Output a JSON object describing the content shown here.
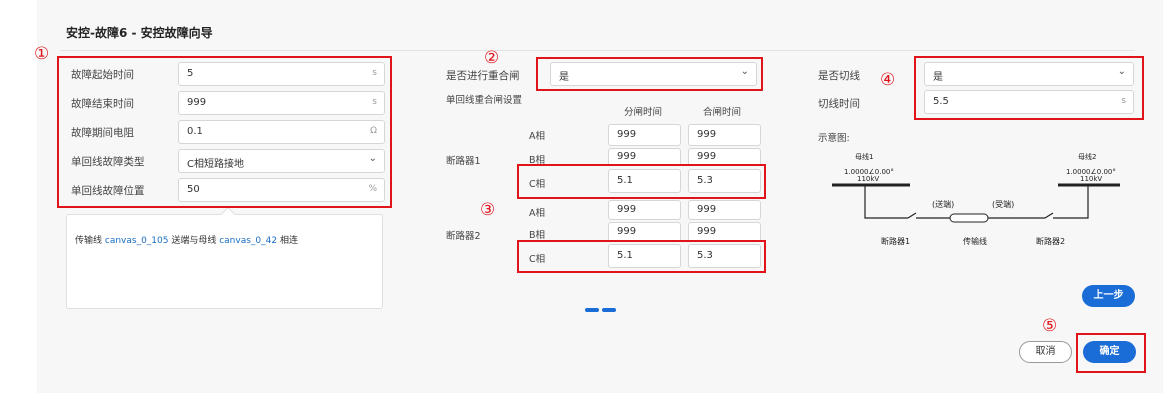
{
  "title": "安控-故障6 - 安控故障向导",
  "fault": {
    "start_label": "故障起始时间",
    "start_value": "5",
    "start_unit": "s",
    "end_label": "故障结束时间",
    "end_value": "999",
    "end_unit": "s",
    "res_label": "故障期间电阻",
    "res_value": "0.1",
    "res_unit": "Ω",
    "type_label": "单回线故障类型",
    "type_value": "C相短路接地",
    "pos_label": "单回线故障位置",
    "pos_value": "50",
    "pos_unit": "%"
  },
  "tooltip": {
    "prefix": "传输线 ",
    "line_name": "canvas_0_105",
    "middle": " 送端与母线 ",
    "bus_name": "canvas_0_42",
    "suffix": " 相连"
  },
  "reclose": {
    "label": "是否进行重合闸",
    "value": "是",
    "section_label": "单回线重合闸设置",
    "col_open": "分闸时间",
    "col_close": "合闸时间",
    "breakers": [
      {
        "name": "断路器1",
        "phases": [
          {
            "phase": "A相",
            "open": "999",
            "close": "999"
          },
          {
            "phase": "B相",
            "open": "999",
            "close": "999"
          },
          {
            "phase": "C相",
            "open": "5.1",
            "close": "5.3"
          }
        ]
      },
      {
        "name": "断路器2",
        "phases": [
          {
            "phase": "A相",
            "open": "999",
            "close": "999"
          },
          {
            "phase": "B相",
            "open": "999",
            "close": "999"
          },
          {
            "phase": "C相",
            "open": "5.1",
            "close": "5.3"
          }
        ]
      }
    ]
  },
  "cut": {
    "label": "是否切线",
    "value": "是",
    "time_label": "切线时间",
    "time_value": "5.5",
    "time_unit": "s"
  },
  "diagram": {
    "label": "示意图:",
    "bus1": "母线1",
    "bus1_v": "1.0000∠0.00°",
    "bus1_kv": "110kV",
    "bus2": "母线2",
    "bus2_v": "1.0000∠0.00°",
    "bus2_kv": "110kV",
    "send": "(送端)",
    "recv": "(受端)",
    "breaker1": "断路器1",
    "line": "传输线",
    "breaker2": "断路器2"
  },
  "buttons": {
    "prev": "上一步",
    "cancel": "取消",
    "ok": "确定"
  },
  "annotations": [
    "①",
    "②",
    "③",
    "④",
    "⑤"
  ],
  "colors": {
    "accent": "#1a6dd7",
    "highlight": "#e0151b"
  }
}
